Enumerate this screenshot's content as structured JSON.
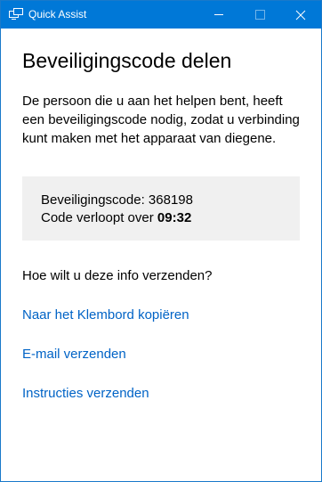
{
  "window": {
    "title": "Quick Assist",
    "accent_color": "#0078d7",
    "icon": "quick-assist-icon"
  },
  "main": {
    "heading": "Beveiligingscode delen",
    "description": "De persoon die u aan het helpen bent, heeft een beveiligingscode nodig, zodat u verbinding kunt maken met het apparaat van diegene.",
    "code_box": {
      "code_label": "Beveiligingscode:",
      "code_value": "368198",
      "expiry_label": "Code verloopt over",
      "expiry_time": "09:32"
    },
    "question": "Hoe wilt u deze info verzenden?",
    "links": [
      {
        "label": "Naar het Klembord kopiëren"
      },
      {
        "label": "E-mail verzenden"
      },
      {
        "label": "Instructies verzenden"
      }
    ],
    "link_color": "#0063c6"
  }
}
